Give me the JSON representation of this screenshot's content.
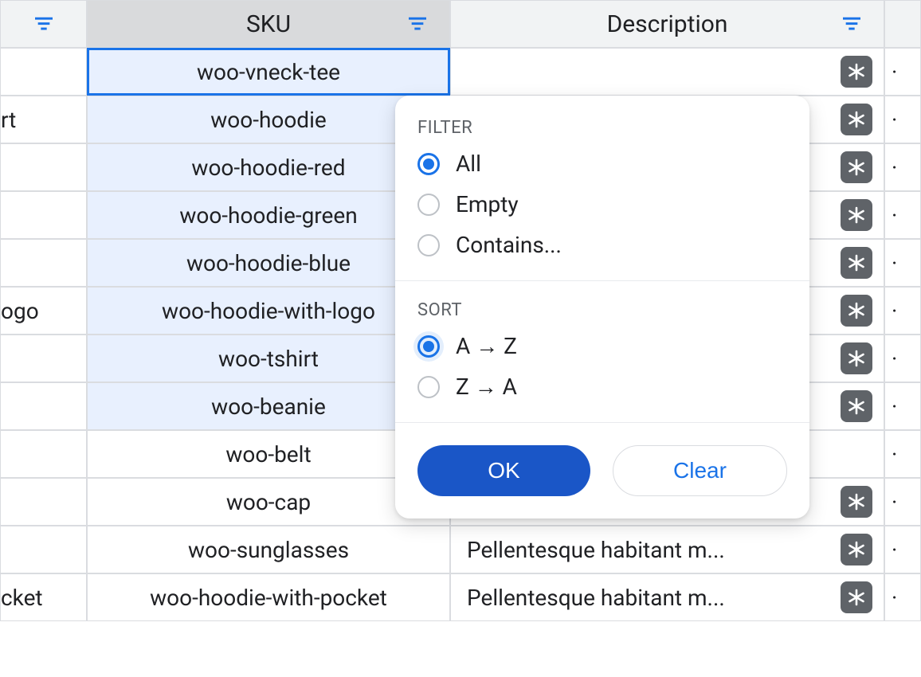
{
  "columns": {
    "col0_fragments": [
      "",
      "rt",
      "",
      "",
      "",
      "ogo",
      "",
      "",
      "",
      "",
      "",
      "cket"
    ],
    "sku": {
      "header": "SKU",
      "rows": [
        "woo-vneck-tee",
        "woo-hoodie",
        "woo-hoodie-red",
        "woo-hoodie-green",
        "woo-hoodie-blue",
        "woo-hoodie-with-logo",
        "woo-tshirt",
        "woo-beanie",
        "woo-belt",
        "woo-cap",
        "woo-sunglasses",
        "woo-hoodie-with-pocket"
      ]
    },
    "description": {
      "header": "Description",
      "rows": [
        {
          "text": "",
          "badge": true
        },
        {
          "text": "",
          "badge": true
        },
        {
          "text": "",
          "badge": true
        },
        {
          "text": "",
          "badge": true
        },
        {
          "text": "",
          "badge": true
        },
        {
          "text": "",
          "badge": true
        },
        {
          "text": "",
          "badge": true
        },
        {
          "text": "",
          "badge": true
        },
        {
          "text": "",
          "badge": false
        },
        {
          "text": "",
          "badge": true
        },
        {
          "text": "Pellentesque habitant m...",
          "badge": true
        },
        {
          "text": "Pellentesque habitant m...",
          "badge": true
        }
      ]
    }
  },
  "popover": {
    "filter_label": "FILTER",
    "filter_options": [
      {
        "label": "All",
        "checked": true
      },
      {
        "label": "Empty",
        "checked": false
      },
      {
        "label": "Contains...",
        "checked": false
      }
    ],
    "sort_label": "SORT",
    "sort_options": [
      {
        "label": "A → Z",
        "checked": true,
        "halo": true
      },
      {
        "label": "Z → A",
        "checked": false,
        "halo": false
      }
    ],
    "ok_label": "OK",
    "clear_label": "Clear"
  },
  "trailing_dots": "·"
}
